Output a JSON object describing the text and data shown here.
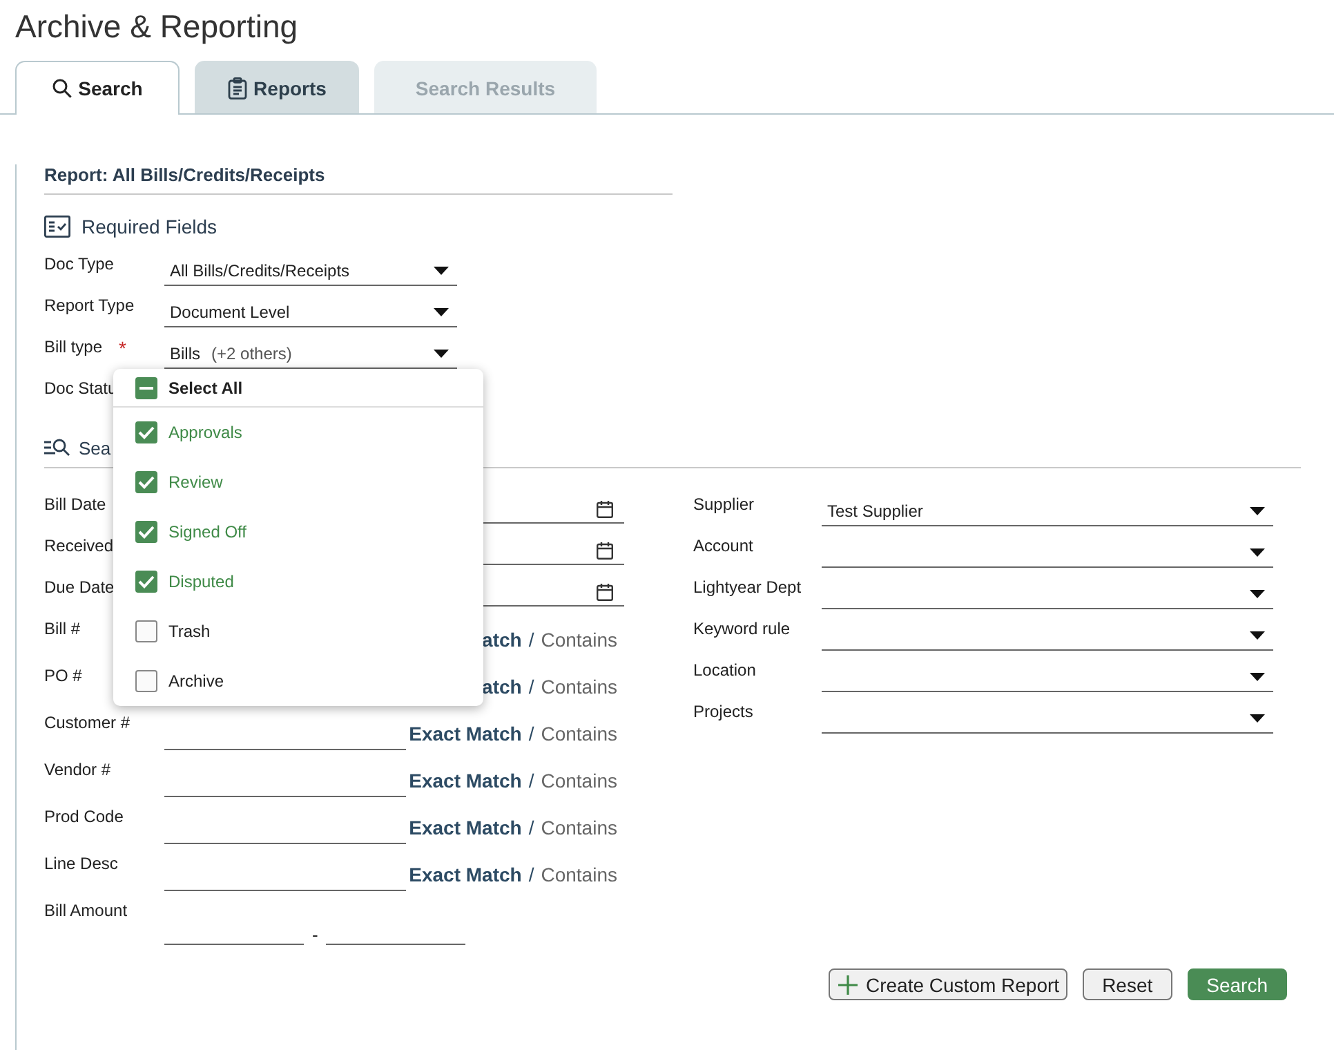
{
  "title": "Archive & Reporting",
  "tabs": [
    {
      "label": "Search",
      "selected": true,
      "disabled": false
    },
    {
      "label": "Reports",
      "selected": false,
      "disabled": false
    },
    {
      "label": "Search Results",
      "selected": false,
      "disabled": true
    }
  ],
  "report_heading": "Report: All Bills/Credits/Receipts",
  "required_section": {
    "title": "Required Fields",
    "fields": [
      {
        "label": "Doc Type",
        "value": "All Bills/Credits/Receipts"
      },
      {
        "label": "Report Type",
        "value": "Document Level"
      },
      {
        "label": "Bill type",
        "required_mark": "*",
        "value": "Bills",
        "extra": "(+2 others)"
      },
      {
        "label": "Doc Statu"
      }
    ]
  },
  "search_section": {
    "title": "Sea",
    "left_fields": [
      {
        "kind": "date",
        "label": "Bill Date"
      },
      {
        "kind": "date",
        "label": "Received"
      },
      {
        "kind": "date",
        "label": "Due Date"
      },
      {
        "kind": "match",
        "label": "Bill #",
        "exact": "atch",
        "separator": "/",
        "contains": "Contains"
      },
      {
        "kind": "match",
        "label": "PO #",
        "exact": "atch",
        "separator": "/",
        "contains": "Contains"
      },
      {
        "kind": "match",
        "label": "Customer #",
        "input_shown": true,
        "exact": "Exact Match",
        "separator": "/",
        "contains": "Contains"
      },
      {
        "kind": "match",
        "label": "Vendor #",
        "input_shown": true,
        "exact": "Exact Match",
        "separator": "/",
        "contains": "Contains"
      },
      {
        "kind": "match",
        "label": "Prod Code",
        "input_shown": true,
        "exact": "Exact Match",
        "separator": "/",
        "contains": "Contains"
      },
      {
        "kind": "match",
        "label": "Line Desc",
        "input_shown": true,
        "exact": "Exact Match",
        "separator": "/",
        "contains": "Contains"
      },
      {
        "kind": "range",
        "label": "Bill Amount",
        "separator": "-"
      }
    ],
    "right_fields": [
      {
        "label": "Supplier",
        "value": "Test Supplier"
      },
      {
        "label": "Account"
      },
      {
        "label": "Lightyear Dept"
      },
      {
        "label": "Keyword rule"
      },
      {
        "label": "Location"
      },
      {
        "label": "Projects"
      }
    ]
  },
  "dropdown": {
    "select_all": {
      "label": "Select All",
      "indeterminate": true
    },
    "items": [
      {
        "label": "Approvals",
        "checked": true
      },
      {
        "label": "Review",
        "checked": true
      },
      {
        "label": "Signed Off",
        "checked": true
      },
      {
        "label": "Disputed",
        "checked": true
      },
      {
        "label": "Trash",
        "checked": false
      },
      {
        "label": "Archive",
        "checked": false
      }
    ]
  },
  "buttons": [
    {
      "label": "Create Custom Report",
      "kind": "add"
    },
    {
      "label": "Reset",
      "kind": "secondary"
    },
    {
      "label": "Search",
      "kind": "primary"
    }
  ]
}
